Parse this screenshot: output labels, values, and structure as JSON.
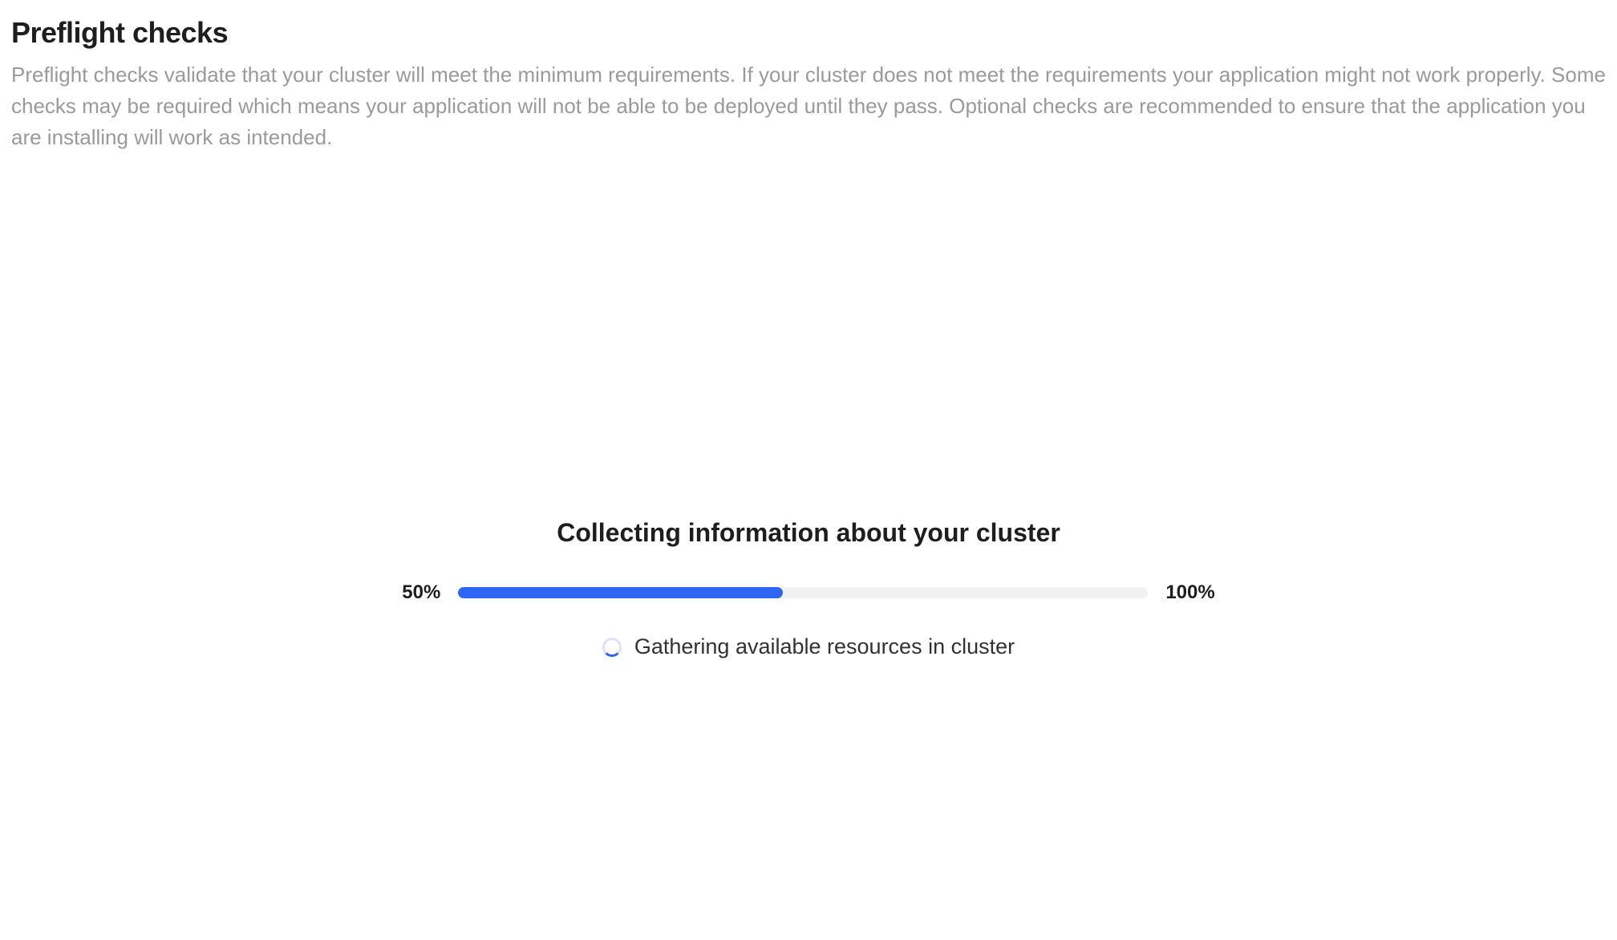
{
  "header": {
    "title": "Preflight checks",
    "description": "Preflight checks validate that your cluster will meet the minimum requirements. If your cluster does not meet the requirements your application might not work properly. Some checks may be required which means your application will not be able to be deployed until they pass. Optional checks are recommended to ensure that the application you are installing will work as intended."
  },
  "progress": {
    "title": "Collecting information about your cluster",
    "left_label": "50%",
    "right_label": "100%",
    "percent": 47,
    "status_text": "Gathering available resources in cluster"
  }
}
